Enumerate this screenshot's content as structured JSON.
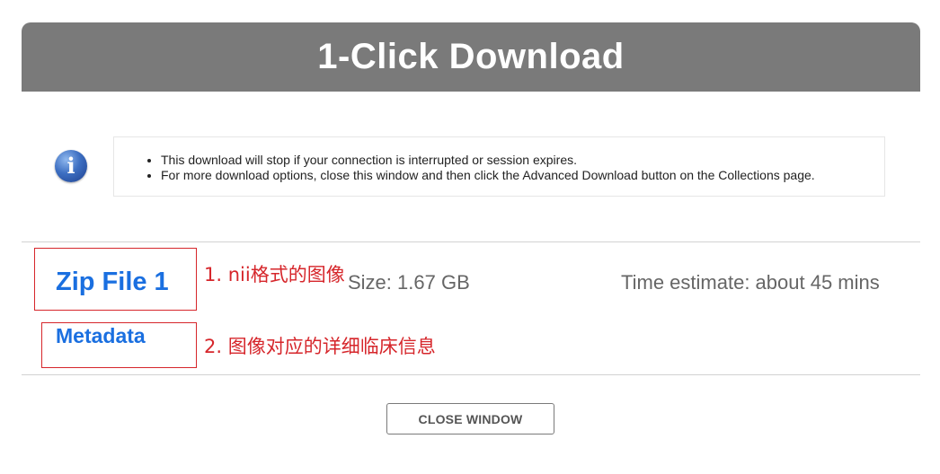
{
  "dialog": {
    "title": "1-Click Download",
    "info_icon": "info-icon",
    "notices": [
      "This download will stop if your connection is interrupted or session expires.",
      "For more download options, close this window and then click the Advanced Download button on the Collections page."
    ]
  },
  "download": {
    "zip_label": "Zip File 1",
    "size": "Size: 1.67 GB",
    "time_estimate": "Time estimate: about 45 mins",
    "metadata_label": "Metadata"
  },
  "annotations": [
    {
      "text": "1. nii格式的图像",
      "color": "#d6262b"
    },
    {
      "text": "2. 图像对应的详细临床信息",
      "color": "#d6262b"
    }
  ],
  "footer": {
    "close_label": "CLOSE WINDOW"
  },
  "colors": {
    "header_bg": "#7a7a7a",
    "link": "#1a6fe0",
    "annotation": "#d6262b",
    "muted_text": "#666666"
  }
}
